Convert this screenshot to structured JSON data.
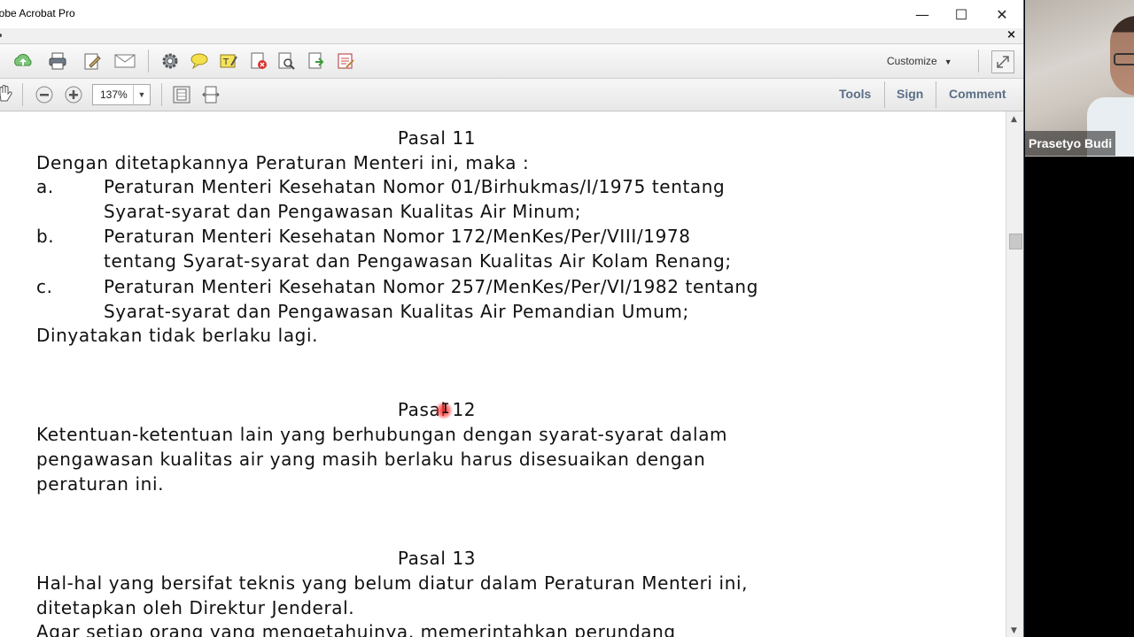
{
  "window": {
    "title": "lobe Acrobat Pro",
    "minimize": "—",
    "maximize": "☐",
    "close": "✕",
    "doc_close": "×"
  },
  "toolbar": {
    "customize": "Customize",
    "zoom_value": "137%"
  },
  "panel_links": {
    "tools": "Tools",
    "sign": "Sign",
    "comment": "Comment"
  },
  "document": {
    "pasal11": "Pasal 11",
    "intro11": "Dengan ditetapkannya Peraturan Menteri ini, maka :",
    "item_a_marker": "a.",
    "item_a_l1": "Peraturan Menteri Kesehatan Nomor 01/Birhukmas/I/1975 tentang",
    "item_a_l2": "Syarat-syarat dan Pengawasan Kualitas Air Minum;",
    "item_b_marker": "b.",
    "item_b_l1": "Peraturan Menteri Kesehatan Nomor 172/MenKes/Per/VIII/1978",
    "item_b_l2": "tentang Syarat-syarat dan Pengawasan Kualitas Air Kolam Renang;",
    "item_c_marker": "c.",
    "item_c_l1": "Peraturan Menteri Kesehatan Nomor 257/MenKes/Per/VI/1982 tentang",
    "item_c_l2": "Syarat-syarat dan Pengawasan Kualitas Air Pemandian Umum;",
    "closing11": "Dinyatakan tidak berlaku lagi.",
    "pasal12": "Pasal 12",
    "p12_l1": "Ketentuan-ketentuan lain yang berhubungan dengan syarat-syarat dalam",
    "p12_l2": "pengawasan kualitas air yang masih berlaku harus disesuaikan dengan",
    "p12_l3": "peraturan ini.",
    "pasal13": "Pasal 13",
    "p13_l1": "Hal-hal yang bersifat teknis yang belum diatur dalam Peraturan Menteri ini,",
    "p13_l2": "ditetapkan oleh Direktur Jenderal.",
    "p13_l3": "Agar setiap orang yang mengetahuinya, memerintahkan perundang"
  },
  "webcam": {
    "name": "Prasetyo Budi"
  }
}
